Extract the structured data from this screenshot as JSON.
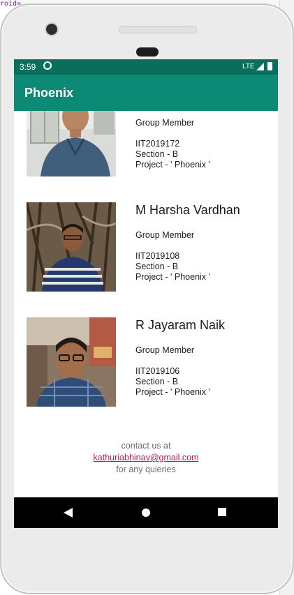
{
  "ide": {
    "top_text": "roid="
  },
  "status_bar": {
    "time": "3:59",
    "network": "LTE"
  },
  "app_bar": {
    "title": "Phoenix"
  },
  "members": [
    {
      "name": "",
      "role": "Group Member",
      "id": "IIT2019172",
      "section": "Section - B",
      "project": "Project - ' Phoenix '"
    },
    {
      "name": "M Harsha Vardhan",
      "role": "Group Member",
      "id": "IIT2019108",
      "section": "Section - B",
      "project": "Project - ' Phoenix '"
    },
    {
      "name": "R Jayaram Naik",
      "role": "Group Member",
      "id": "IIT2019106",
      "section": "Section - B",
      "project": "Project - ' Phoenix '"
    }
  ],
  "contact": {
    "line1": "contact us at",
    "email": "kathuriabhinav@gmail.com",
    "line3": "for any quieries"
  },
  "colors": {
    "status_bar": "#0a6e5c",
    "app_bar": "#0c8a76",
    "email_link": "#c2185b",
    "nav_bar": "#000000"
  }
}
